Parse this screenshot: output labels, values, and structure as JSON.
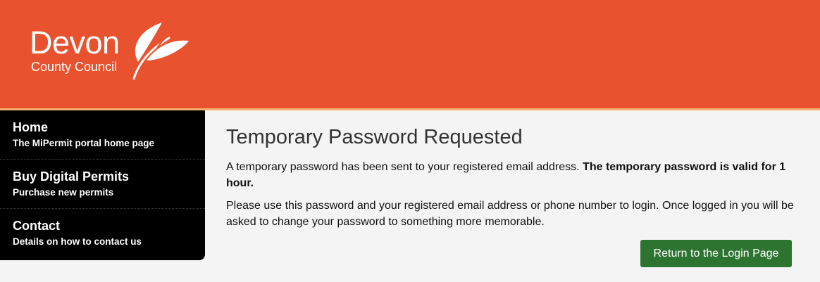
{
  "header": {
    "logo": {
      "name": "Devon",
      "subtitle": "County Council"
    },
    "colors": {
      "banner": "#e9522e",
      "stripe": "#f3b16b"
    }
  },
  "sidebar": {
    "items": [
      {
        "title": "Home",
        "description": "The MiPermit portal home page"
      },
      {
        "title": "Buy Digital Permits",
        "description": "Purchase new permits"
      },
      {
        "title": "Contact",
        "description": "Details on how to contact us"
      }
    ]
  },
  "main": {
    "title": "Temporary Password Requested",
    "paragraph1": "A temporary password has been sent to your registered email address. ",
    "paragraph1_bold": "The temporary password is valid for 1 hour.",
    "paragraph2": "Please use this password and your registered email address or phone number to login. Once logged in you will be asked to change your password to something more memorable.",
    "button_label": "Return to the Login Page",
    "button_color": "#2e7431"
  }
}
